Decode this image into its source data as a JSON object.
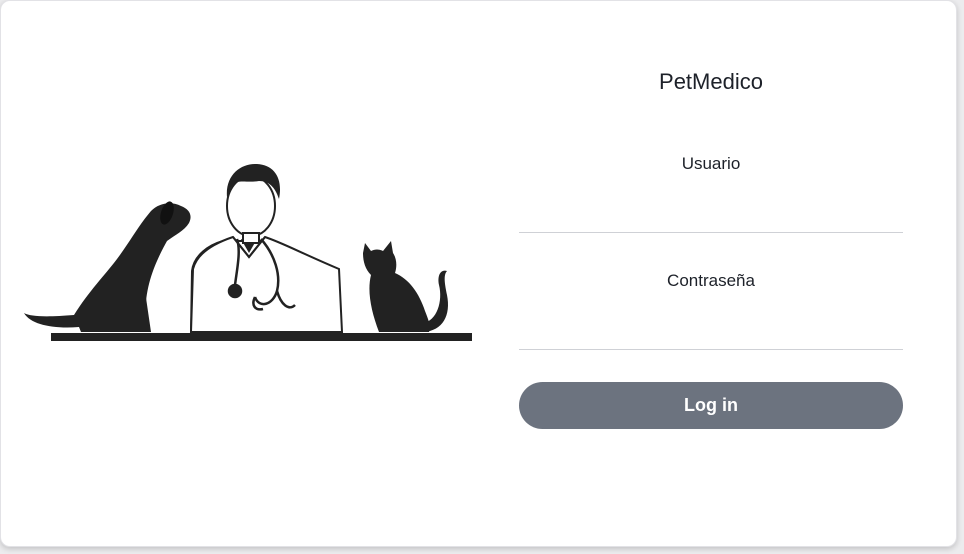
{
  "app": {
    "title": "PetMedico"
  },
  "form": {
    "username_label": "Usuario",
    "username_value": "",
    "password_label": "Contraseña",
    "password_value": "",
    "login_label": "Log in"
  },
  "colors": {
    "button": "#6c737f",
    "text": "#1d2129",
    "illustration": "#222222",
    "divider": "#cfd1d6"
  },
  "icons": [
    "dog-silhouette-icon",
    "veterinarian-icon",
    "stethoscope-icon",
    "cat-silhouette-icon"
  ]
}
